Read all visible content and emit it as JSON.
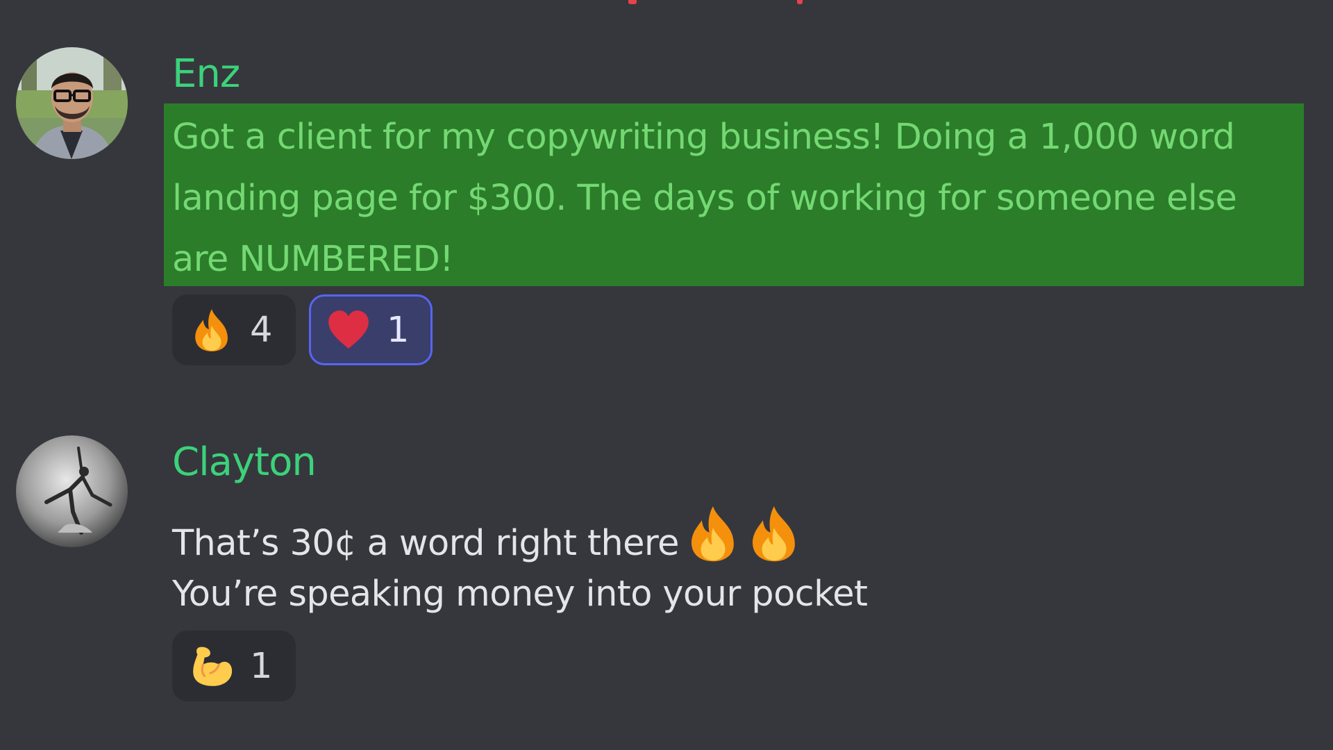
{
  "colors": {
    "background": "#36373d",
    "username": "#3bd27a",
    "highlight_bg": "#2b7d2a",
    "highlight_text": "#74d873",
    "message_text": "#e4e5e8",
    "reaction_bg": "#2b2d33",
    "reaction_selected_border": "#5865f2"
  },
  "messages": [
    {
      "username": "Enz",
      "text": "Got a client for my copywriting business! Doing a 1,000 word\nlanding page for $300. The days of working for someone else\nare NUMBERED!",
      "highlighted": true,
      "reactions": [
        {
          "emoji": "fire-icon",
          "count": "4",
          "selected": false
        },
        {
          "emoji": "heart-icon",
          "count": "1",
          "selected": true
        }
      ]
    },
    {
      "username": "Clayton",
      "lines": [
        {
          "text": "That’s 30¢ a word right there",
          "trailing_emojis": [
            "fire-icon",
            "fire-icon"
          ]
        },
        {
          "text": "You’re speaking money into your pocket"
        }
      ],
      "reactions": [
        {
          "emoji": "flexed-biceps-icon",
          "count": "1",
          "selected": false
        }
      ]
    }
  ]
}
